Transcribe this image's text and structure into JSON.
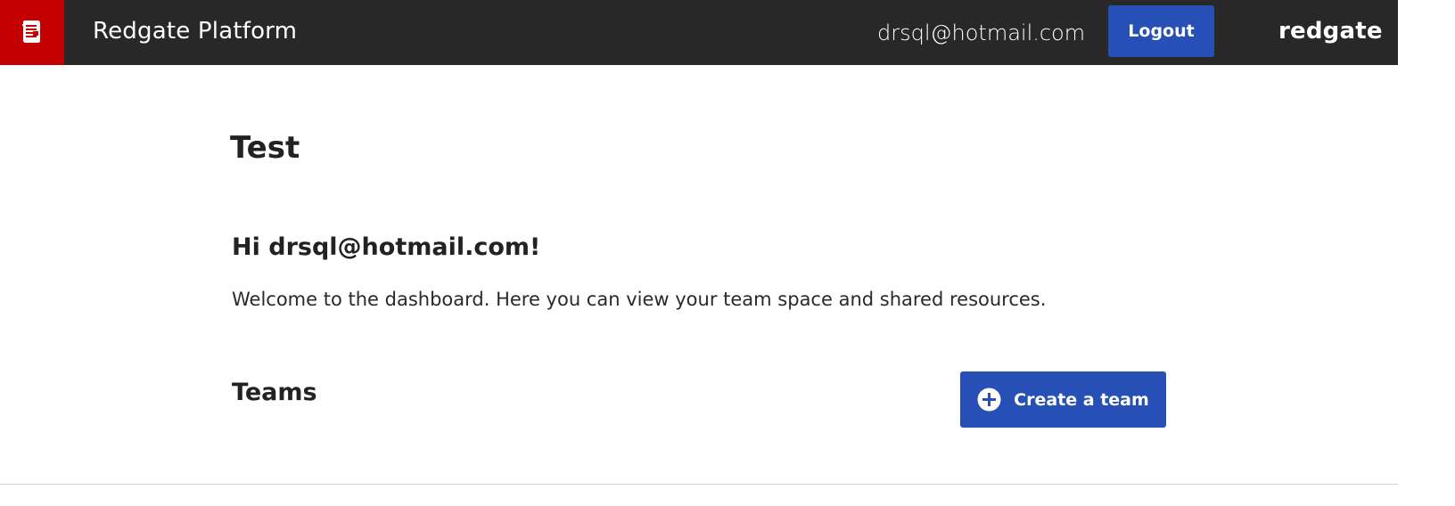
{
  "header": {
    "app_title": "Redgate Platform",
    "user_email": "drsql@hotmail.com",
    "logout_label": "Logout",
    "brand": "redgate",
    "logo_icon": "redgate-platform-logo-icon"
  },
  "main": {
    "page_title": "Test",
    "greeting": "Hi drsql@hotmail.com!",
    "welcome_text": "Welcome to the dashboard. Here you can view your team space and shared resources.",
    "teams_title": "Teams",
    "create_team_label": "Create a team",
    "create_team_icon": "plus-circle-icon"
  },
  "colors": {
    "header_bg": "#282828",
    "logo_bg": "#c40001",
    "button_blue": "#2650b5"
  }
}
